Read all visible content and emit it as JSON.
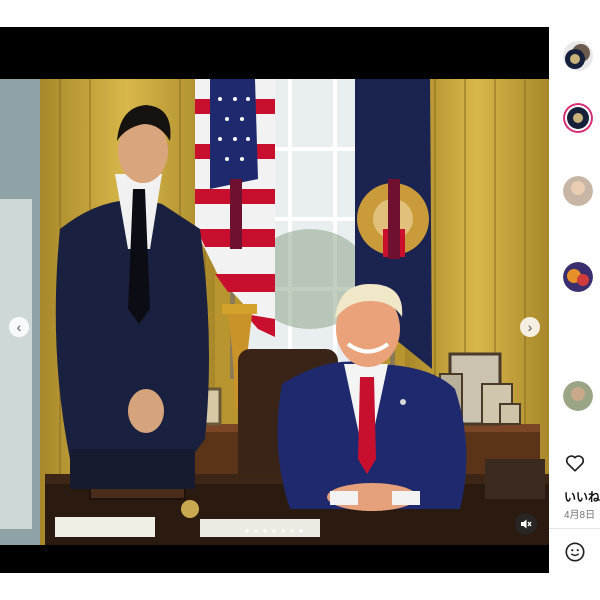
{
  "post": {
    "like_label": "いいね",
    "date": "4月8日",
    "carousel": {
      "slide_count": 7,
      "active_index": 6
    }
  },
  "colors": {
    "curtain": "#c9a43a",
    "suit_navy": "#1f2a55",
    "tie_red": "#c8102e",
    "story_ring": "#d62976"
  },
  "icons": {
    "prev": "chevron-left-icon",
    "next": "chevron-right-icon",
    "mute": "muted-speaker-icon",
    "like": "heart-icon",
    "emoji": "smiley-icon"
  }
}
